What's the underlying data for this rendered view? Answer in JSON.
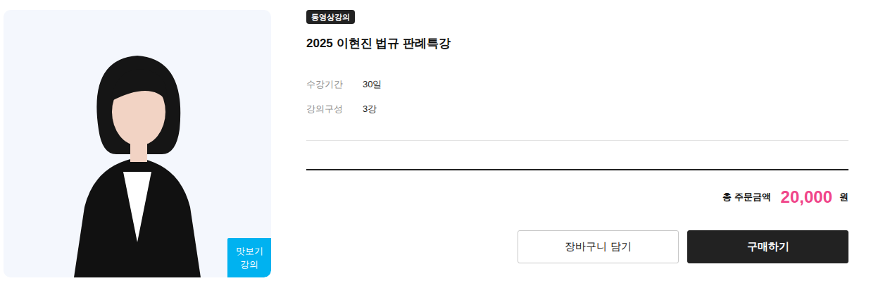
{
  "thumbnail": {
    "badge_lines": [
      "맛보기",
      "강의"
    ]
  },
  "product": {
    "category_tag": "동영상강의",
    "title": "2025 이현진 법규 판례특강",
    "info": [
      {
        "label": "수강기간",
        "value": "30일"
      },
      {
        "label": "강의구성",
        "value": "3강"
      }
    ]
  },
  "total": {
    "label": "총 주문금액",
    "amount": "20,000",
    "unit": "원"
  },
  "buttons": [
    {
      "label": "장바구니 담기",
      "kind": "outline"
    },
    {
      "label": "구매하기",
      "kind": "primary"
    }
  ]
}
